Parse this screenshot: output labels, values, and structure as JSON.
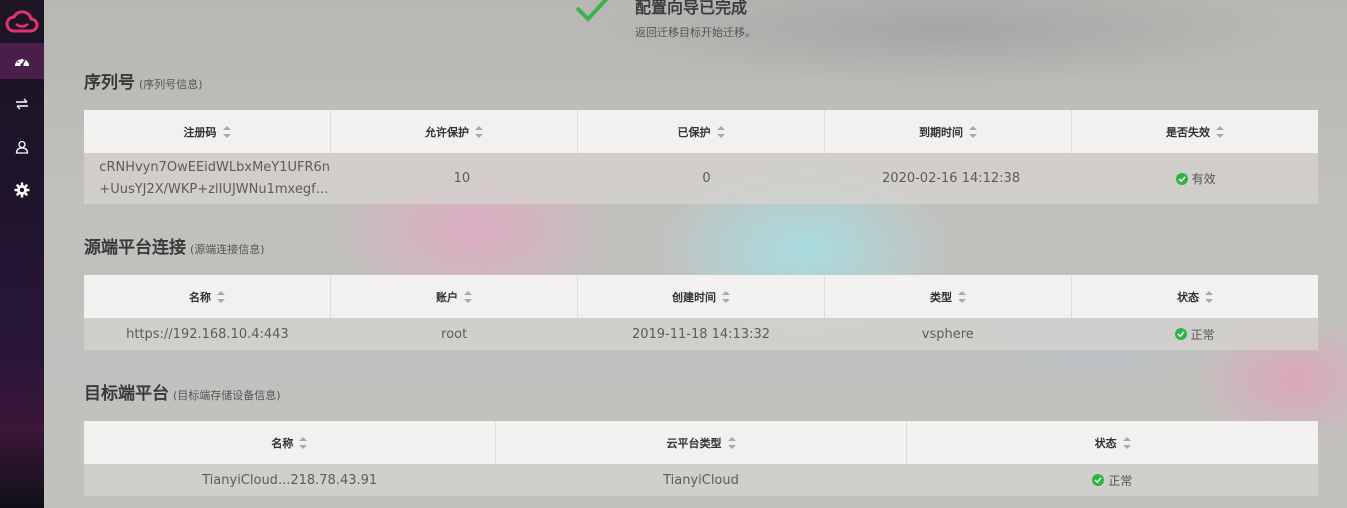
{
  "banner": {
    "title": "配置向导已完成",
    "subtitle": "返回迁移目标开始迁移。"
  },
  "sidebar": {
    "items": [
      {
        "icon": "dashboard-icon",
        "active": true
      },
      {
        "icon": "transfer-arrows-icon",
        "active": false
      },
      {
        "icon": "user-icon",
        "active": false
      },
      {
        "icon": "gear-icon",
        "active": false
      }
    ]
  },
  "serial": {
    "title": "序列号",
    "subtitle": "(序列号信息)",
    "headers": [
      "注册码",
      "允许保护",
      "已保护",
      "到期时间",
      "是否失效"
    ],
    "row": {
      "code_line1": "cRNHvyn7OwEEidWLbxMeY1UFR6n",
      "code_line2": "+UusYJ2X/WKP+zlIUJWNu1mxegf…",
      "allowed": "10",
      "protected": "0",
      "expires": "2020-02-16 14:12:38",
      "status": "有效"
    }
  },
  "source": {
    "title": "源端平台连接",
    "subtitle": "(源端连接信息)",
    "headers": [
      "名称",
      "账户",
      "创建时间",
      "类型",
      "状态"
    ],
    "row": {
      "name": "https://192.168.10.4:443",
      "account": "root",
      "created": "2019-11-18 14:13:32",
      "type": "vsphere",
      "status": "正常"
    }
  },
  "target": {
    "title": "目标端平台",
    "subtitle": "(目标端存储设备信息)",
    "headers": [
      "名称",
      "云平台类型",
      "状态"
    ],
    "row": {
      "name": "TianyiCloud...218.78.43.91",
      "platform": "TianyiCloud",
      "status": "正常"
    }
  },
  "colors": {
    "accent": "#e0336e",
    "success": "#2fb344",
    "sidebar_active": "#4a1e4a"
  }
}
